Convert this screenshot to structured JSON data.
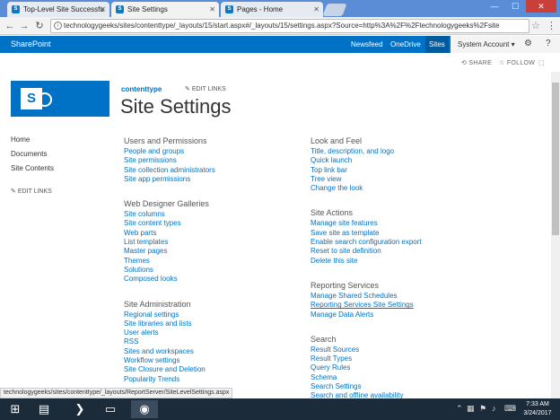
{
  "browser": {
    "tabs": [
      {
        "title": "Top-Level Site Successfu"
      },
      {
        "title": "Site Settings"
      },
      {
        "title": "Pages - Home"
      }
    ],
    "url": "technologygeeks/sites/contenttype/_layouts/15/start.aspx#/_layouts/15/settings.aspx?Source=http%3A%2F%2Ftechnologygeeks%2Fsite"
  },
  "suitebar": {
    "brand": "SharePoint",
    "links": [
      "Newsfeed",
      "OneDrive",
      "Sites"
    ],
    "account": "System Account ▾"
  },
  "actions": {
    "share": "SHARE",
    "follow": "FOLLOW"
  },
  "header": {
    "site_name": "contenttype",
    "edit_links": "EDIT LINKS",
    "title": "Site Settings"
  },
  "leftnav": {
    "items": [
      "Home",
      "Documents",
      "Site Contents"
    ],
    "edit_links": "EDIT LINKS"
  },
  "columns": [
    [
      {
        "title": "Users and Permissions",
        "links": [
          "People and groups",
          "Site permissions",
          "Site collection administrators",
          "Site app permissions"
        ]
      },
      {
        "title": "Web Designer Galleries",
        "links": [
          "Site columns",
          "Site content types",
          "Web parts",
          "List templates",
          "Master pages",
          "Themes",
          "Solutions",
          "Composed looks"
        ]
      },
      {
        "title": "Site Administration",
        "links": [
          "Regional settings",
          "Site libraries and lists",
          "User alerts",
          "RSS",
          "Sites and workspaces",
          "Workflow settings",
          "Site Closure and Deletion",
          "Popularity Trends"
        ]
      }
    ],
    [
      {
        "title": "Look and Feel",
        "links": [
          "Title, description, and logo",
          "Quick launch",
          "Top link bar",
          "Tree view",
          "Change the look"
        ]
      },
      {
        "title": "Site Actions",
        "links": [
          "Manage site features",
          "Save site as template",
          "Enable search configuration export",
          "Reset to site definition",
          "Delete this site"
        ]
      },
      {
        "title": "Reporting Services",
        "links": [
          "Manage Shared Schedules",
          "Reporting Services Site Settings",
          "Manage Data Alerts"
        ]
      },
      {
        "title": "Search",
        "links": [
          "Result Sources",
          "Result Types",
          "Query Rules",
          "Schema",
          "Search Settings",
          "Search and offline availability"
        ]
      }
    ]
  ],
  "statusbar": "technologygeeks/sites/contenttype/_layouts/ReportServer/SiteLevelSettings.aspx",
  "taskbar": {
    "time": "7:33 AM",
    "date": "3/24/2017"
  }
}
